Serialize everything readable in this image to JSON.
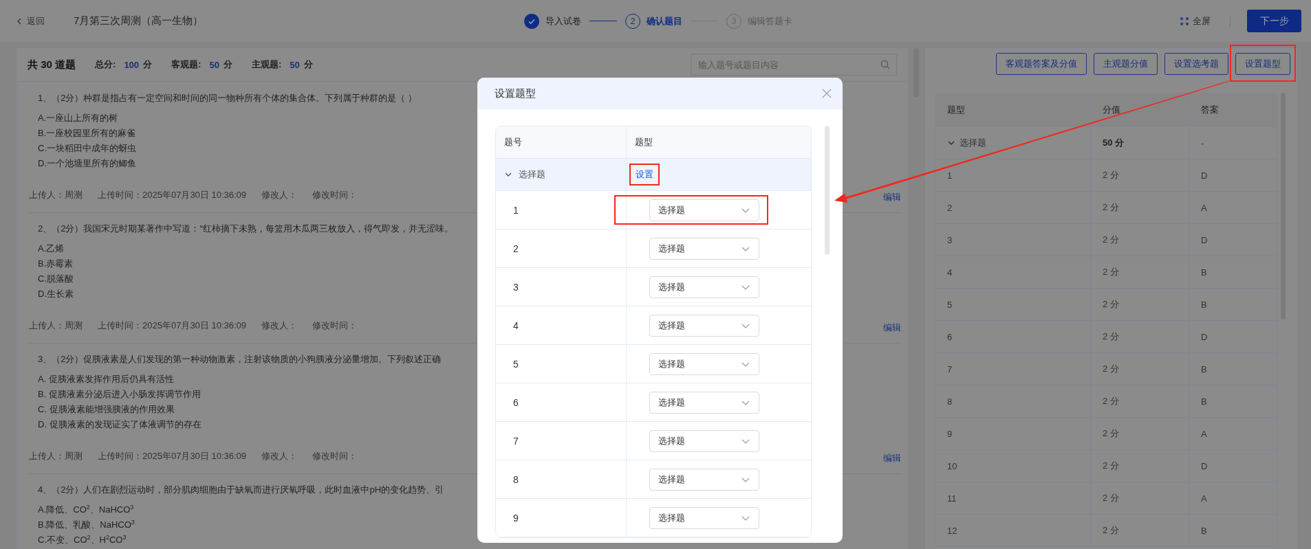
{
  "header": {
    "back": "返回",
    "title": "7月第三次周测（高一生物）",
    "steps": [
      {
        "label": "导入试卷",
        "completed": true,
        "current": false
      },
      {
        "number": "2",
        "label": "确认题目",
        "completed": false,
        "current": true
      },
      {
        "number": "3",
        "label": "编辑答题卡",
        "completed": false,
        "current": false
      }
    ],
    "fullscreen": "全屏",
    "next": "下一步"
  },
  "question_panel": {
    "total": "共 30 道题",
    "scores": [
      {
        "label": "总分:",
        "value": "100",
        "unit": "分"
      },
      {
        "label": "客观题:",
        "value": "50",
        "unit": "分"
      },
      {
        "label": "主观题:",
        "value": "50",
        "unit": "分"
      }
    ],
    "search": {
      "placeholder": "输入题号或题目内容"
    },
    "questions": [
      {
        "title": "1、（2分）种群是指占有一定空间和时间的同一物种所有个体的集合体。下列属于种群的是（ ）",
        "options": [
          "A.一座山上所有的树",
          "B.一座校园里所有的麻雀",
          "C.一块稻田中成年的蚜虫",
          "D.一个池塘里所有的鲫鱼"
        ],
        "meta": [
          "上传人：周测",
          "上传时间：2025年07月30日 10:36:09",
          "修改人：",
          "修改时间："
        ],
        "edit": "编辑"
      },
      {
        "title": "2、（2分）我国宋元时期某著作中写道：“红柿摘下未熟，每篮用木瓜两三枚放入，得气即发，并无涩味。",
        "options": [
          "A.乙烯",
          "B.赤霉素",
          "C.脱落酸",
          "D.生长素"
        ],
        "meta": [
          "上传人：周测",
          "上传时间：2025年07月30日 10:36:09",
          "修改人：",
          "修改时间："
        ],
        "edit": "编辑"
      },
      {
        "title": "3、（2分）促胰液素是人们发现的第一种动物激素，注射该物质的小狗胰液分泌量增加。下列叙述正确",
        "options": [
          "A. 促胰液素发挥作用后仍具有活性",
          "B. 促胰液素分泌后进入小肠发挥调节作用",
          "C. 促胰液素能增强胰液的作用效果",
          "D. 促胰液素的发现证实了体液调节的存在"
        ],
        "meta": [
          "上传人：周测",
          "上传时间：2025年07月30日 10:36:09",
          "修改人：",
          "修改时间："
        ],
        "edit": "编辑"
      },
      {
        "title": "4、（2分）人们在剧烈运动时，部分肌肉细胞由于缺氧而进行厌氧呼吸，此时血液中pH的变化趋势、引",
        "options": [
          "A.降低、CO$^{2}$、NaHCO$^{3}$",
          "B.降低、乳酸、NaHCO$^{3}$",
          "C.不变、CO$^{2}$、H$^{2}$CO$^{3}$"
        ]
      }
    ]
  },
  "score_panel": {
    "buttons": [
      {
        "label": "客观题答案及分值",
        "highlighted": false
      },
      {
        "label": "主观题分值",
        "highlighted": false
      },
      {
        "label": "设置选考题",
        "highlighted": false
      },
      {
        "label": "设置题型",
        "highlighted": true
      }
    ],
    "columns": [
      "题型",
      "分值",
      "答案"
    ],
    "group": {
      "name": "选择题",
      "expanded": true,
      "score": "50 分",
      "answer": "-"
    },
    "rows": [
      [
        "1",
        "2 分",
        "D"
      ],
      [
        "2",
        "2 分",
        "A"
      ],
      [
        "3",
        "2 分",
        "D"
      ],
      [
        "4",
        "2 分",
        "B"
      ],
      [
        "5",
        "2 分",
        "B"
      ],
      [
        "6",
        "2 分",
        "D"
      ],
      [
        "7",
        "2 分",
        "B"
      ],
      [
        "8",
        "2 分",
        "B"
      ],
      [
        "9",
        "2 分",
        "A"
      ],
      [
        "10",
        "2 分",
        "D"
      ],
      [
        "11",
        "2 分",
        "A"
      ],
      [
        "12",
        "2 分",
        "B"
      ]
    ]
  },
  "modal": {
    "title": "设置题型",
    "columns": [
      "题号",
      "题型"
    ],
    "group": {
      "name": "选择题",
      "expanded": true,
      "action": "设置",
      "highlighted": true
    },
    "rows": [
      {
        "number": "1",
        "type": "选择题",
        "highlighted": true
      },
      {
        "number": "2",
        "type": "选择题",
        "highlighted": false
      },
      {
        "number": "3",
        "type": "选择题",
        "highlighted": false
      },
      {
        "number": "4",
        "type": "选择题",
        "highlighted": false
      },
      {
        "number": "5",
        "type": "选择题",
        "highlighted": false
      },
      {
        "number": "6",
        "type": "选择题",
        "highlighted": false
      },
      {
        "number": "7",
        "type": "选择题",
        "highlighted": false
      },
      {
        "number": "8",
        "type": "选择题",
        "highlighted": false
      },
      {
        "number": "9",
        "type": "选择题",
        "highlighted": false
      }
    ]
  }
}
